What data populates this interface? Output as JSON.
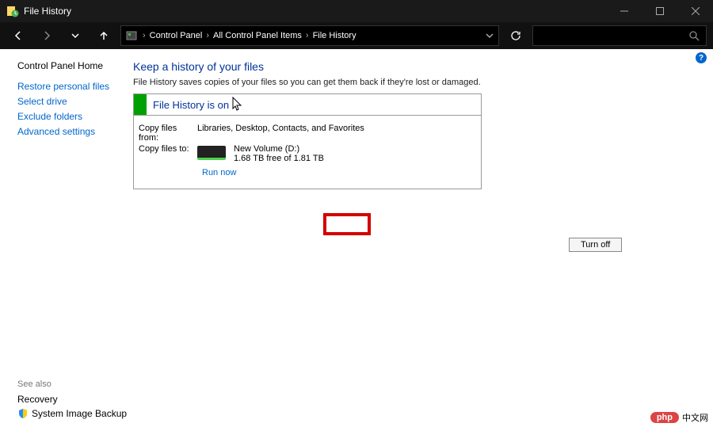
{
  "titlebar": {
    "title": "File History"
  },
  "breadcrumbs": {
    "b0": "Control Panel",
    "b1": "All Control Panel Items",
    "b2": "File History"
  },
  "left": {
    "home": "Control Panel Home",
    "restore": "Restore personal files",
    "select_drive": "Select drive",
    "exclude": "Exclude folders",
    "advanced": "Advanced settings"
  },
  "seealso": {
    "heading": "See also",
    "recovery": "Recovery",
    "imgbackup": "System Image Backup"
  },
  "main": {
    "heading": "Keep a history of your files",
    "desc": "File History saves copies of your files so you can get them back if they're lost or damaged.",
    "status_title": "File History is on",
    "copy_from_label": "Copy files from:",
    "copy_from_value": "Libraries, Desktop, Contacts, and Favorites",
    "copy_to_label": "Copy files to:",
    "drive_name": "New Volume (D:)",
    "drive_free": "1.68 TB free of 1.81 TB",
    "run_now": "Run now",
    "turn_off": "Turn off"
  },
  "watermark": {
    "pill": "php",
    "text": "中文网"
  }
}
